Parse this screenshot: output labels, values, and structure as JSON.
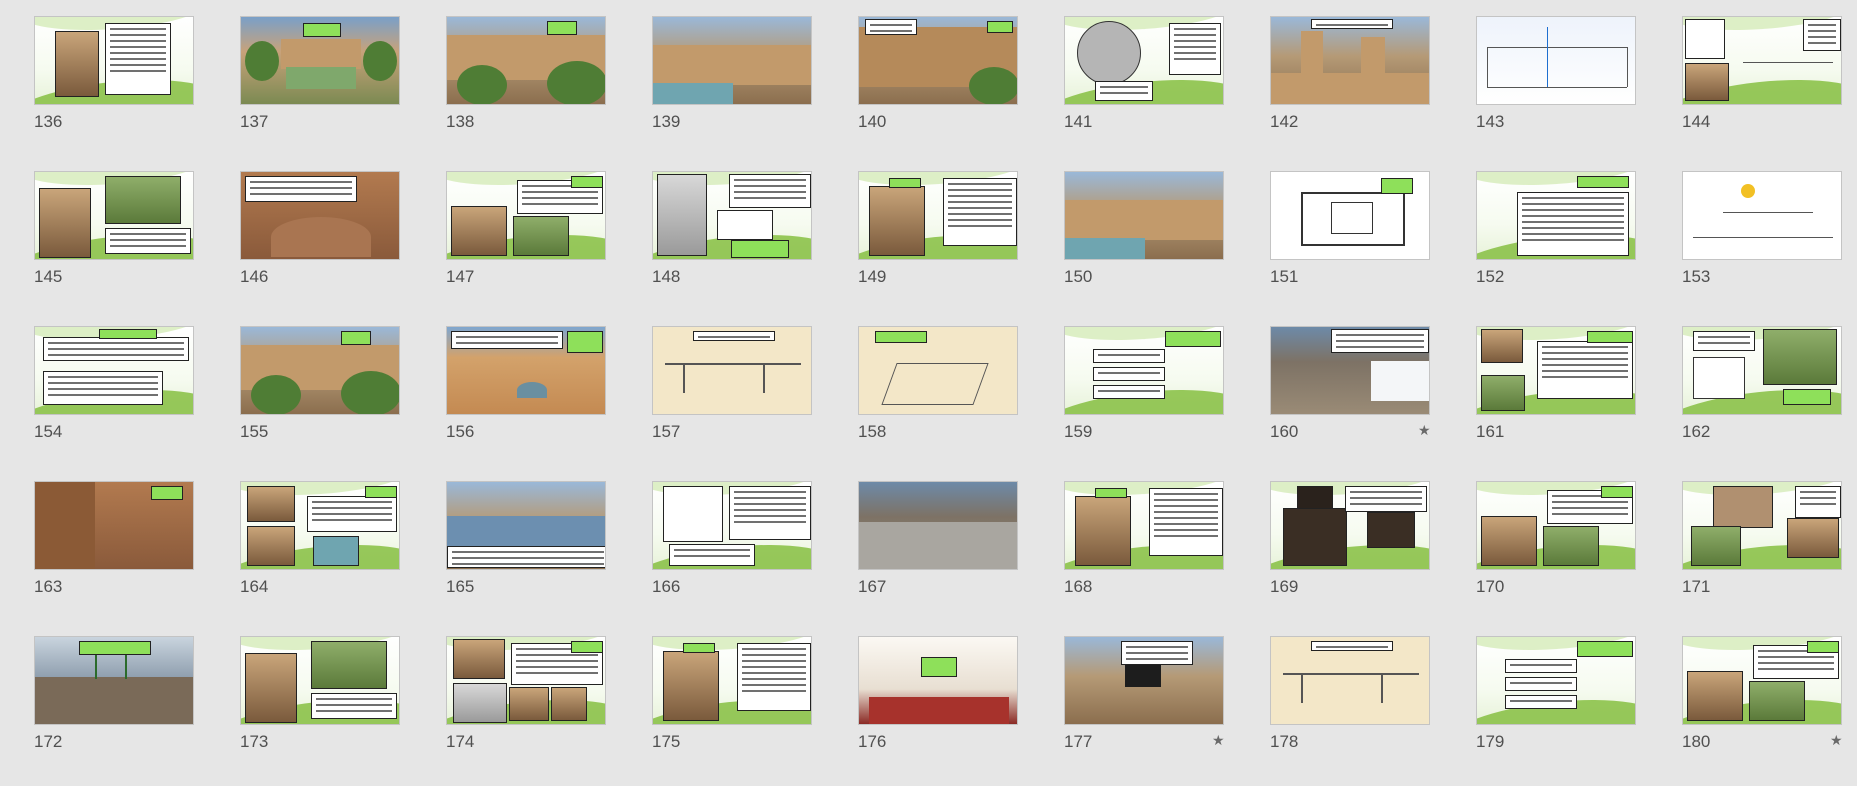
{
  "view": "slide-sorter",
  "slides": [
    {
      "number": "136",
      "starred": false,
      "style": "slide",
      "thumb": "text-with-photo"
    },
    {
      "number": "137",
      "starred": false,
      "style": "photo2",
      "thumb": "garden-pool"
    },
    {
      "number": "138",
      "starred": false,
      "style": "photo",
      "thumb": "courtyard-trees"
    },
    {
      "number": "139",
      "starred": false,
      "style": "photo",
      "thumb": "courtyard-pool"
    },
    {
      "number": "140",
      "starred": false,
      "style": "photo",
      "thumb": "courtyard-arches"
    },
    {
      "number": "141",
      "starred": false,
      "style": "slide",
      "thumb": "circle-diagram"
    },
    {
      "number": "142",
      "starred": false,
      "style": "photo",
      "thumb": "windcatchers"
    },
    {
      "number": "143",
      "starred": false,
      "style": "blue",
      "thumb": "section-drawing"
    },
    {
      "number": "144",
      "starred": false,
      "style": "slide",
      "thumb": "sketch-and-photo"
    },
    {
      "number": "145",
      "starred": false,
      "style": "slide",
      "thumb": "two-photos"
    },
    {
      "number": "146",
      "starred": false,
      "style": "mud",
      "thumb": "mud-domes"
    },
    {
      "number": "147",
      "starred": false,
      "style": "slide",
      "thumb": "two-photos-text"
    },
    {
      "number": "148",
      "starred": false,
      "style": "slide",
      "thumb": "diagrams"
    },
    {
      "number": "149",
      "starred": false,
      "style": "slide",
      "thumb": "photo-text"
    },
    {
      "number": "150",
      "starred": false,
      "style": "photo",
      "thumb": "courtyard-pool"
    },
    {
      "number": "151",
      "starred": false,
      "style": "sketch",
      "thumb": "plan-drawing"
    },
    {
      "number": "152",
      "starred": false,
      "style": "slide",
      "thumb": "bullet-list"
    },
    {
      "number": "153",
      "starred": false,
      "style": "sketch",
      "thumb": "sun-sketch"
    },
    {
      "number": "154",
      "starred": false,
      "style": "slide",
      "thumb": "text-boxes"
    },
    {
      "number": "155",
      "starred": false,
      "style": "photo",
      "thumb": "courtyard-trees"
    },
    {
      "number": "156",
      "starred": false,
      "style": "desert",
      "thumb": "desert-town"
    },
    {
      "number": "157",
      "starred": false,
      "style": "paper",
      "thumb": "paper-section"
    },
    {
      "number": "158",
      "starred": false,
      "style": "paper",
      "thumb": "paper-iso"
    },
    {
      "number": "159",
      "starred": false,
      "style": "slide",
      "thumb": "flow-boxes"
    },
    {
      "number": "160",
      "starred": true,
      "style": "village",
      "thumb": "snow-village"
    },
    {
      "number": "161",
      "starred": false,
      "style": "slide",
      "thumb": "photos-text"
    },
    {
      "number": "162",
      "starred": false,
      "style": "slide",
      "thumb": "model-photo"
    },
    {
      "number": "163",
      "starred": false,
      "style": "mud",
      "thumb": "alley"
    },
    {
      "number": "164",
      "starred": false,
      "style": "slide",
      "thumb": "three-photos"
    },
    {
      "number": "165",
      "starred": false,
      "style": "photo",
      "thumb": "balcony-house"
    },
    {
      "number": "166",
      "starred": false,
      "style": "slide",
      "thumb": "diagram-text"
    },
    {
      "number": "167",
      "starred": false,
      "style": "village",
      "thumb": "hill-village"
    },
    {
      "number": "168",
      "starred": false,
      "style": "slide",
      "thumb": "photo-text"
    },
    {
      "number": "169",
      "starred": false,
      "style": "slide",
      "thumb": "dark-photos"
    },
    {
      "number": "170",
      "starred": false,
      "style": "slide",
      "thumb": "two-photos-text"
    },
    {
      "number": "171",
      "starred": false,
      "style": "slide",
      "thumb": "collage"
    },
    {
      "number": "172",
      "starred": false,
      "style": "snow",
      "thumb": "snow-roof"
    },
    {
      "number": "173",
      "starred": false,
      "style": "slide",
      "thumb": "two-photos"
    },
    {
      "number": "174",
      "starred": false,
      "style": "slide",
      "thumb": "collage-text"
    },
    {
      "number": "175",
      "starred": false,
      "style": "slide",
      "thumb": "photo-text"
    },
    {
      "number": "176",
      "starred": false,
      "style": "interior",
      "thumb": "interior-room"
    },
    {
      "number": "177",
      "starred": true,
      "style": "photo",
      "thumb": "window-facade"
    },
    {
      "number": "178",
      "starred": false,
      "style": "paper",
      "thumb": "paper-section"
    },
    {
      "number": "179",
      "starred": false,
      "style": "slide",
      "thumb": "flow-boxes"
    },
    {
      "number": "180",
      "starred": true,
      "style": "slide",
      "thumb": "two-photos-text"
    }
  ],
  "star_glyph": "★"
}
